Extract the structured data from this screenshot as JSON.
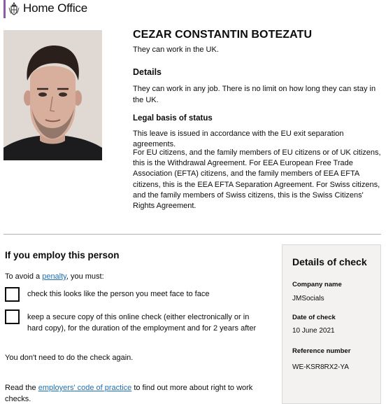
{
  "header": {
    "organisation": "Home Office",
    "crest_icon": "royal-crest-icon",
    "accent_color": "#8e5aa8"
  },
  "person": {
    "name": "CEZAR CONSTANTIN BOTEZATU",
    "status_line": "They can work in the UK."
  },
  "details": {
    "heading": "Details",
    "text": "They can work in any job. There is no limit on how long they can stay in the UK."
  },
  "legal": {
    "heading": "Legal basis of status",
    "para1": "This leave is issued in accordance with the EU exit separation agreements.",
    "para2": "For EU citizens, and the family members of EU citizens or of UK citizens, this is the Withdrawal Agreement. For EEA European Free Trade Association (EFTA) citizens, and the family members of EEA EFTA citizens, this is the EEA EFTA Separation Agreement. For Swiss citizens, and the family members of Swiss citizens, this is the Swiss Citizens' Rights Agreement."
  },
  "employ": {
    "heading": "If you employ this person",
    "avoid_prefix": "To avoid a ",
    "penalty_link": "penalty",
    "avoid_suffix": ", you must:",
    "check1": "check this looks like the person you meet face to face",
    "check2": "keep a secure copy of this online check (either electronically or in hard copy), for the duration of the employment and for 2 years after",
    "no_recheck": "You don't need to do the check again.",
    "code_prefix": "Read the ",
    "code_link": "employers' code of practice",
    "code_suffix": " to find out more about right to work checks."
  },
  "check_panel": {
    "title": "Details of check",
    "company_label": "Company name",
    "company_value": "JMSocials",
    "date_label": "Date of check",
    "date_value": "10 June 2021",
    "ref_label": "Reference number",
    "ref_value": "WE-KSR8RX2-YA"
  }
}
